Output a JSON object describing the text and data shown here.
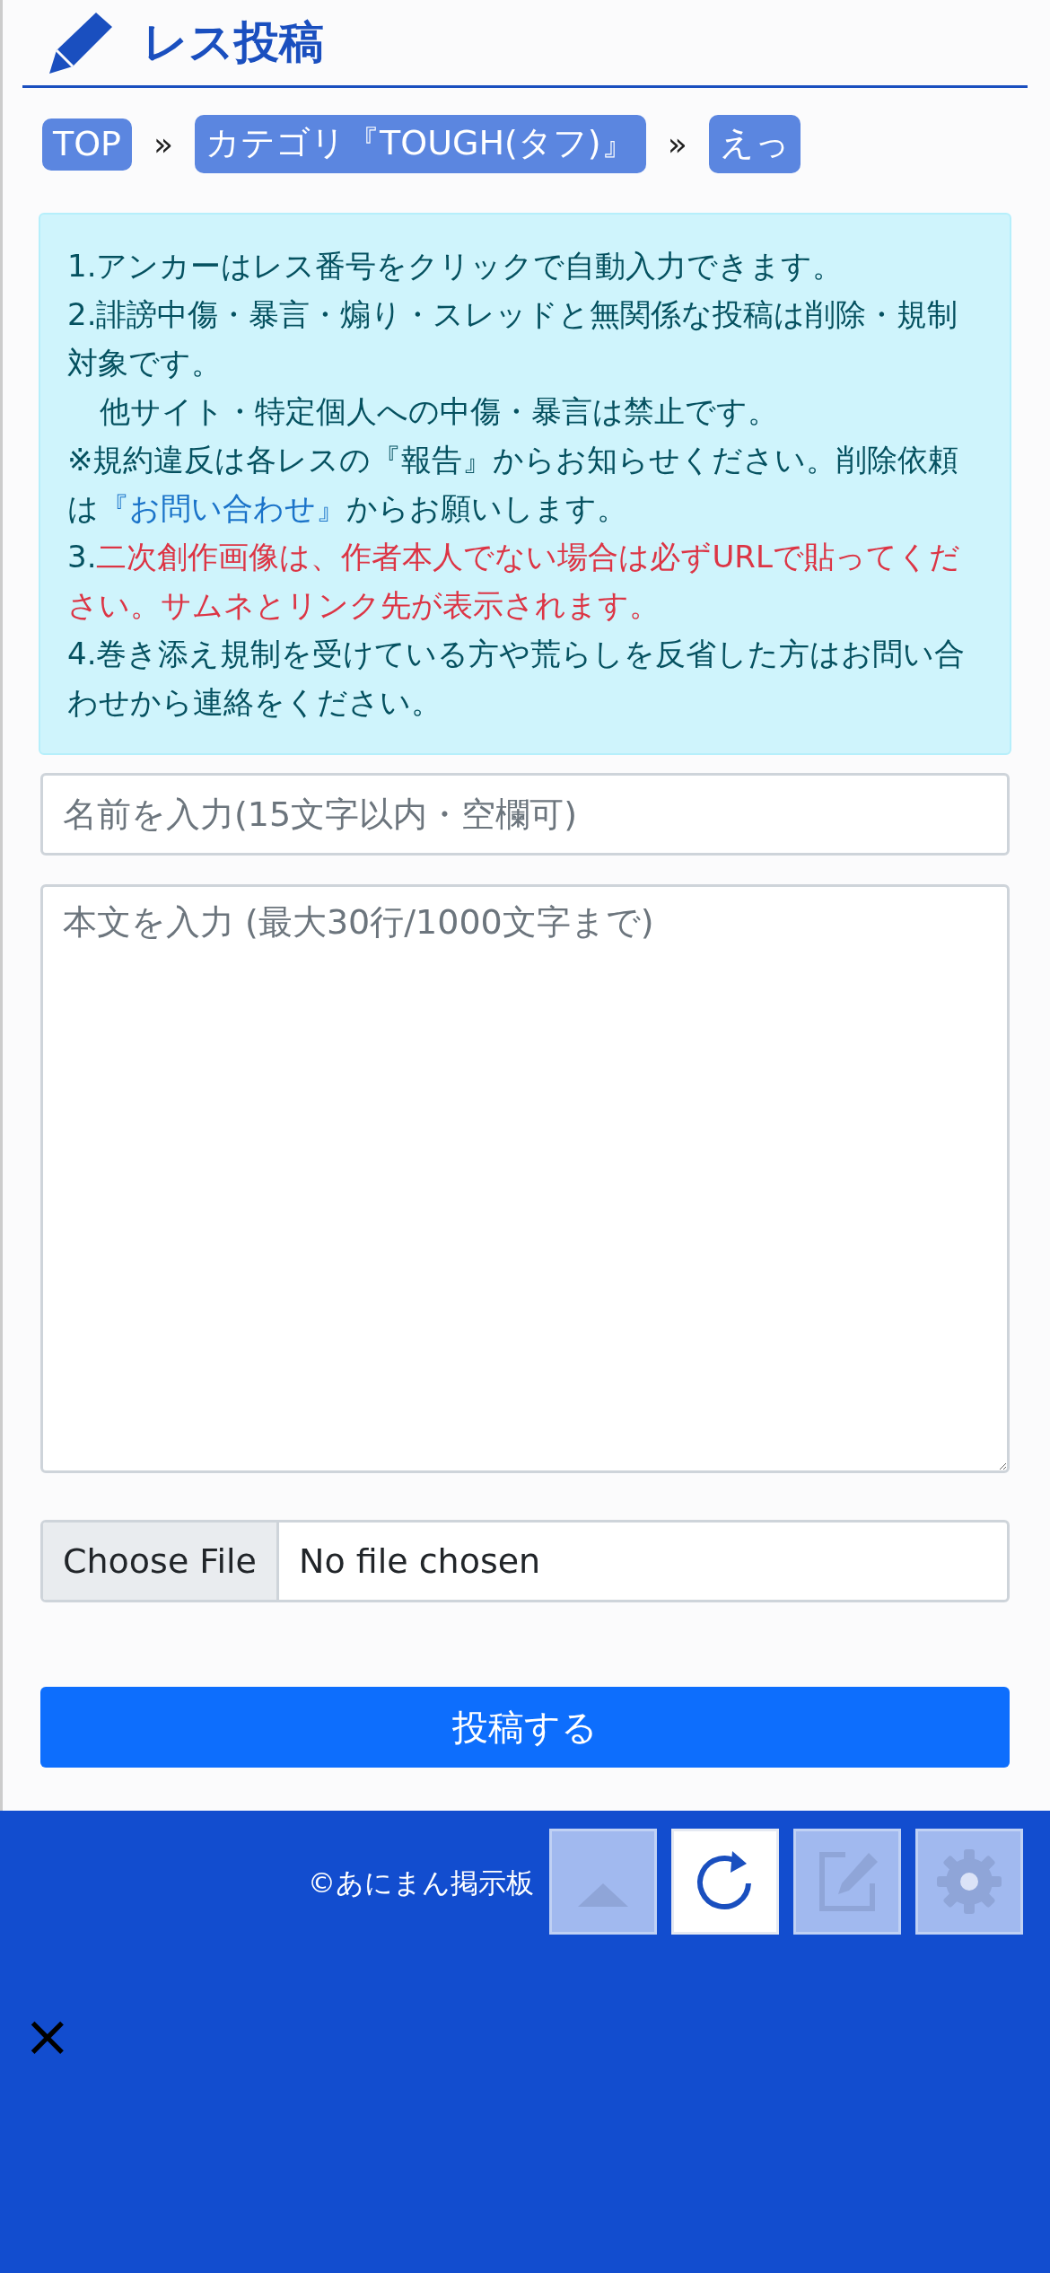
{
  "header": {
    "title": "レス投稿"
  },
  "breadcrumbs": [
    {
      "label": "TOP"
    },
    {
      "label": "カテゴリ『TOUGH(タフ)』"
    },
    {
      "label": "えっ"
    }
  ],
  "breadcrumb_separator": "»",
  "notice": [
    {
      "kind": "normal",
      "parts": [
        {
          "kind": "plain",
          "text": "1.アンカーはレス番号をクリックで自動入力できます。"
        }
      ]
    },
    {
      "kind": "normal",
      "parts": [
        {
          "kind": "plain",
          "text": "2.誹謗中傷・暴言・煽り・スレッドと無関係な投稿は削除・規制対象です。"
        }
      ]
    },
    {
      "kind": "indented",
      "parts": [
        {
          "kind": "plain",
          "text": "他サイト・特定個人への中傷・暴言は禁止です。"
        }
      ]
    },
    {
      "kind": "normal",
      "parts": [
        {
          "kind": "plain",
          "text": "※規約違反は各レスの『報告』からお知らせください。削除依頼は"
        },
        {
          "kind": "link",
          "text": "『お問い合わせ』"
        },
        {
          "kind": "plain",
          "text": "からお願いします。"
        }
      ]
    },
    {
      "kind": "normal",
      "parts": [
        {
          "kind": "plain",
          "text": "3."
        },
        {
          "kind": "warning",
          "text": "二次創作画像は、作者本人でない場合は必ずURLで貼ってください。サムネとリンク先が表示されます。"
        }
      ]
    },
    {
      "kind": "normal",
      "parts": [
        {
          "kind": "plain",
          "text": "4.巻き添え規制を受けている方や荒らしを反省した方はお問い合わせから連絡をください。"
        }
      ]
    }
  ],
  "name_field": {
    "placeholder": "名前を入力(15文字以内・空欄可)"
  },
  "body_field": {
    "placeholder": "本文を入力 (最大30行/1000文字まで)"
  },
  "file_input": {
    "button": "Choose File",
    "status": "No file chosen"
  },
  "submit_button": {
    "label": "投稿する"
  },
  "footer": {
    "copyright": "©あにまん掲示板"
  },
  "floating_buttons": [
    {
      "kind": "up",
      "active": false
    },
    {
      "kind": "reload",
      "active": true
    },
    {
      "kind": "edit",
      "active": false
    },
    {
      "kind": "settings",
      "active": false
    }
  ],
  "close_button": {
    "label": "×"
  }
}
